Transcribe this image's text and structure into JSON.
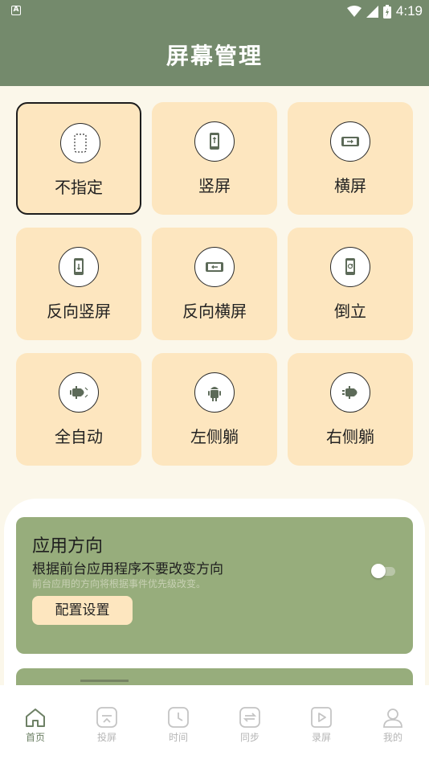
{
  "status_bar": {
    "time": "4:19"
  },
  "header": {
    "title": "屏幕管理"
  },
  "orientation_options": [
    {
      "label": "不指定",
      "icon": "dashed-phone-icon",
      "selected": true
    },
    {
      "label": "竖屏",
      "icon": "portrait-phone-icon",
      "selected": false
    },
    {
      "label": "横屏",
      "icon": "landscape-phone-icon",
      "selected": false
    },
    {
      "label": "反向竖屏",
      "icon": "reverse-portrait-icon",
      "selected": false
    },
    {
      "label": "反向横屏",
      "icon": "reverse-landscape-icon",
      "selected": false
    },
    {
      "label": "倒立",
      "icon": "rotate-phone-icon",
      "selected": false
    },
    {
      "label": "全自动",
      "icon": "android-auto-icon",
      "selected": false
    },
    {
      "label": "左侧躺",
      "icon": "android-left-icon",
      "selected": false
    },
    {
      "label": "右侧躺",
      "icon": "android-right-icon",
      "selected": false
    }
  ],
  "app_direction_card": {
    "title": "应用方向",
    "subtitle": "根据前台应用程序不要改变方向",
    "description": "前台应用的方向将根据事件优先级改变。",
    "button_label": "配置设置",
    "toggle_on": false
  },
  "bottom_nav": [
    {
      "label": "首页",
      "icon": "home-icon",
      "active": true
    },
    {
      "label": "投屏",
      "icon": "cast-icon",
      "active": false
    },
    {
      "label": "时间",
      "icon": "clock-icon",
      "active": false
    },
    {
      "label": "同步",
      "icon": "sync-icon",
      "active": false
    },
    {
      "label": "录屏",
      "icon": "record-icon",
      "active": false
    },
    {
      "label": "我的",
      "icon": "profile-icon",
      "active": false
    }
  ],
  "colors": {
    "header": "#748a6c",
    "tile": "#fde6bf",
    "card": "#97ad7c",
    "background": "#fbf7ea",
    "nav_active": "#6d8065"
  }
}
